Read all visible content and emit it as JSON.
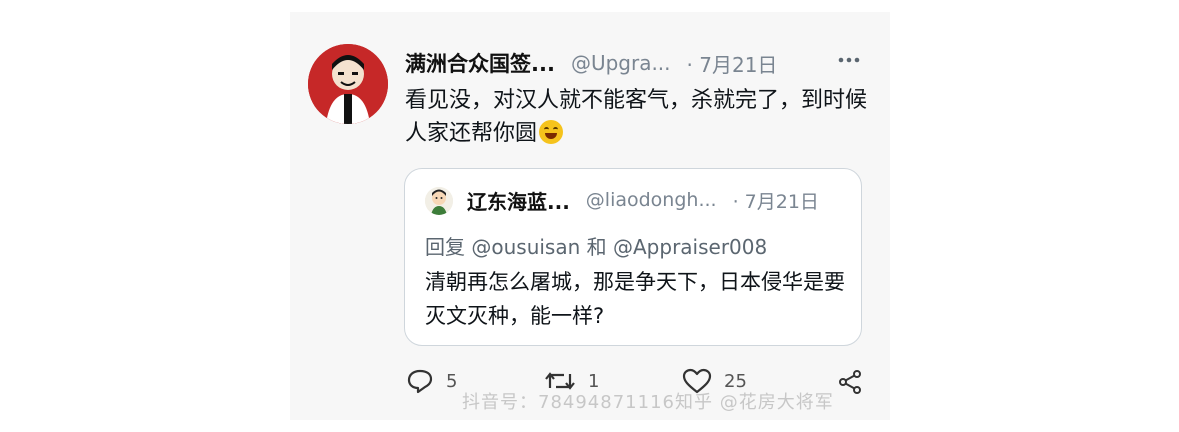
{
  "tweet": {
    "display_name": "满洲合众国签...",
    "handle": "@Upgra...",
    "date": "· 7月21日",
    "text": "看见没，对汉人就不能客气，杀就完了，到时候人家还帮你圆"
  },
  "quoted": {
    "display_name": "辽东海蓝...",
    "handle": "@liaodongh...",
    "date": "· 7月21日",
    "reply_prefix": "回复",
    "reply_user1": "@ousuisan",
    "reply_and": "和",
    "reply_user2": "@Appraiser008",
    "text": "清朝再怎么屠城，那是争天下，日本侵华是要灭文灭种，能一样?"
  },
  "actions": {
    "reply_count": "5",
    "retweet_count": "1",
    "like_count": "25"
  },
  "watermark": "抖音号：78494871116知乎 @花房大将军",
  "icons": {
    "more": "more-icon",
    "reply": "reply-icon",
    "retweet": "retweet-icon",
    "like": "like-icon",
    "share": "share-icon",
    "emoji": "laughing-emoji-icon"
  }
}
